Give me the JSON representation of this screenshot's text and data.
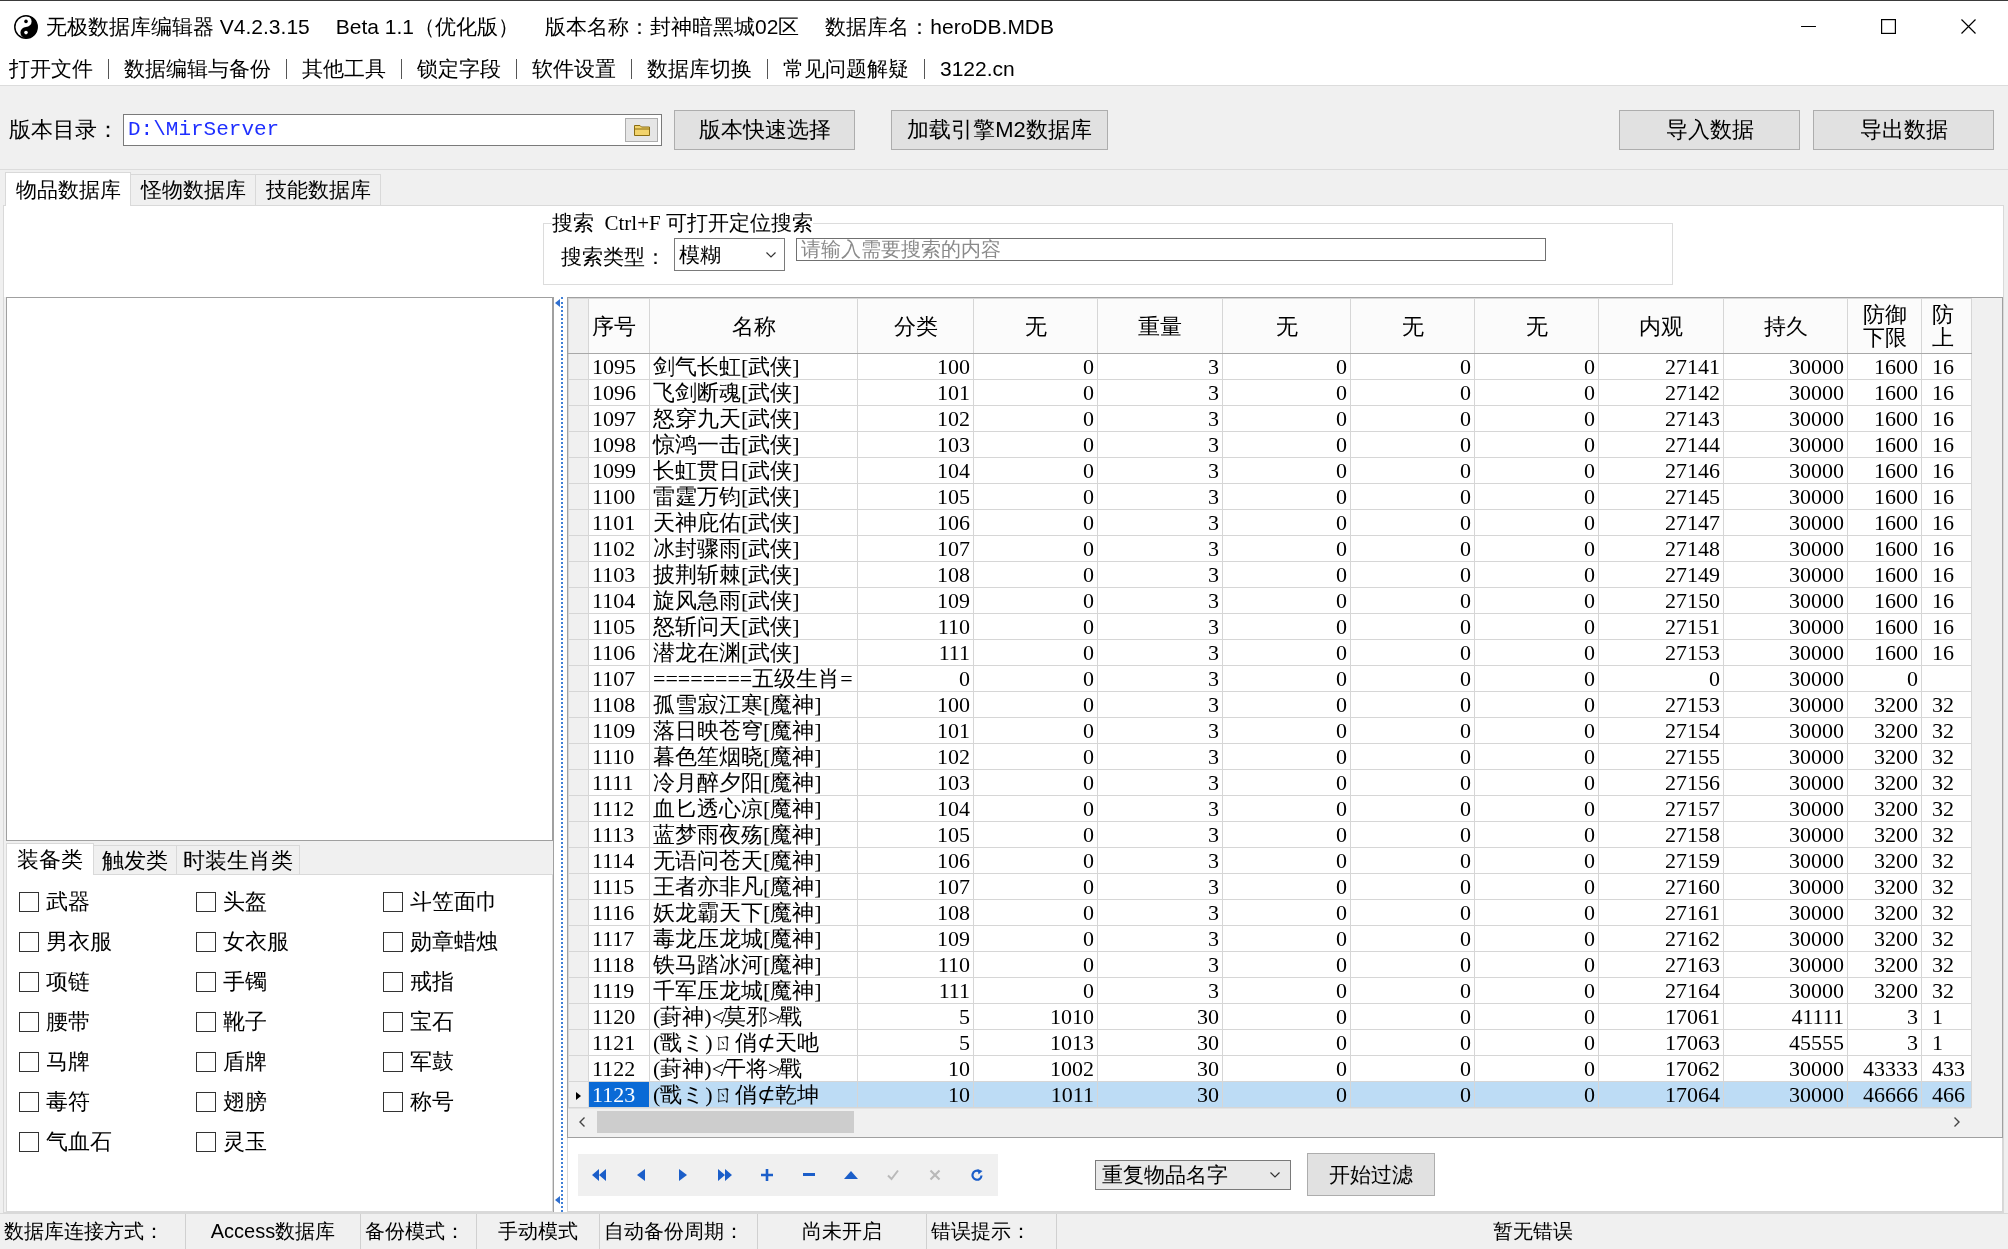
{
  "window": {
    "title_parts": [
      "无极数据库编辑器 V4.2.3.15",
      "Beta 1.1（优化版）",
      "版本名称：封神暗黑城02区",
      "数据库名：heroDB.MDB"
    ]
  },
  "menu": [
    "打开文件",
    "数据编辑与备份",
    "其他工具",
    "锁定字段",
    "软件设置",
    "数据库切换",
    "常见问题解疑",
    "3122.cn"
  ],
  "toolbar": {
    "path_label": "版本目录：",
    "path_value": "D:\\MirServer",
    "left_buttons": [
      "版本快速选择",
      "加载引擎M2数据库"
    ],
    "right_buttons": [
      "导入数据",
      "导出数据"
    ]
  },
  "tabs": [
    {
      "label": "物品数据库",
      "selected": true
    },
    {
      "label": "怪物数据库",
      "selected": false
    },
    {
      "label": "技能数据库",
      "selected": false
    }
  ],
  "search": {
    "title": "搜索  Ctrl+F 可打开定位搜索",
    "type_label": "搜索类型：",
    "type_value": "模糊",
    "placeholder": "请输入需要搜索的内容"
  },
  "category_tabs": [
    {
      "label": "装备类",
      "selected": true
    },
    {
      "label": "触发类",
      "selected": false
    },
    {
      "label": "时装生肖类",
      "selected": false
    }
  ],
  "categories": [
    {
      "label": "武器",
      "checked": false
    },
    {
      "label": "头盔",
      "checked": false
    },
    {
      "label": "斗笠面巾",
      "checked": false
    },
    {
      "label": "男衣服",
      "checked": false
    },
    {
      "label": "女衣服",
      "checked": false
    },
    {
      "label": "勋章蜡烛",
      "checked": false
    },
    {
      "label": "项链",
      "checked": false
    },
    {
      "label": "手镯",
      "checked": false
    },
    {
      "label": "戒指",
      "checked": false
    },
    {
      "label": "腰带",
      "checked": false
    },
    {
      "label": "靴子",
      "checked": false
    },
    {
      "label": "宝石",
      "checked": false
    },
    {
      "label": "马牌",
      "checked": false
    },
    {
      "label": "盾牌",
      "checked": false
    },
    {
      "label": "军鼓",
      "checked": false
    },
    {
      "label": "毒符",
      "checked": false
    },
    {
      "label": "翅膀",
      "checked": false
    },
    {
      "label": "称号",
      "checked": false
    },
    {
      "label": "气血石",
      "checked": false
    },
    {
      "label": "灵玉",
      "checked": false
    }
  ],
  "table": {
    "columns": [
      "序号",
      "名称",
      "分类",
      "无",
      "重量",
      "无",
      "无",
      "无",
      "内观",
      "持久",
      "防御下限",
      "防上"
    ],
    "rows": [
      {
        "selected": false,
        "cells": [
          "1095",
          "剑气长虹[武侠]",
          "100",
          "0",
          "3",
          "0",
          "0",
          "0",
          "27141",
          "30000",
          "1600",
          "16"
        ]
      },
      {
        "selected": false,
        "cells": [
          "1096",
          "飞剑断魂[武侠]",
          "101",
          "0",
          "3",
          "0",
          "0",
          "0",
          "27142",
          "30000",
          "1600",
          "16"
        ]
      },
      {
        "selected": false,
        "cells": [
          "1097",
          "怒穿九天[武侠]",
          "102",
          "0",
          "3",
          "0",
          "0",
          "0",
          "27143",
          "30000",
          "1600",
          "16"
        ]
      },
      {
        "selected": false,
        "cells": [
          "1098",
          "惊鸿一击[武侠]",
          "103",
          "0",
          "3",
          "0",
          "0",
          "0",
          "27144",
          "30000",
          "1600",
          "16"
        ]
      },
      {
        "selected": false,
        "cells": [
          "1099",
          "长虹贯日[武侠]",
          "104",
          "0",
          "3",
          "0",
          "0",
          "0",
          "27146",
          "30000",
          "1600",
          "16"
        ]
      },
      {
        "selected": false,
        "cells": [
          "1100",
          "雷霆万钧[武侠]",
          "105",
          "0",
          "3",
          "0",
          "0",
          "0",
          "27145",
          "30000",
          "1600",
          "16"
        ]
      },
      {
        "selected": false,
        "cells": [
          "1101",
          "天神庇佑[武侠]",
          "106",
          "0",
          "3",
          "0",
          "0",
          "0",
          "27147",
          "30000",
          "1600",
          "16"
        ]
      },
      {
        "selected": false,
        "cells": [
          "1102",
          "冰封骤雨[武侠]",
          "107",
          "0",
          "3",
          "0",
          "0",
          "0",
          "27148",
          "30000",
          "1600",
          "16"
        ]
      },
      {
        "selected": false,
        "cells": [
          "1103",
          "披荆斩棘[武侠]",
          "108",
          "0",
          "3",
          "0",
          "0",
          "0",
          "27149",
          "30000",
          "1600",
          "16"
        ]
      },
      {
        "selected": false,
        "cells": [
          "1104",
          "旋风急雨[武侠]",
          "109",
          "0",
          "3",
          "0",
          "0",
          "0",
          "27150",
          "30000",
          "1600",
          "16"
        ]
      },
      {
        "selected": false,
        "cells": [
          "1105",
          "怒斩问天[武侠]",
          "110",
          "0",
          "3",
          "0",
          "0",
          "0",
          "27151",
          "30000",
          "1600",
          "16"
        ]
      },
      {
        "selected": false,
        "cells": [
          "1106",
          "潜龙在渊[武侠]",
          "111",
          "0",
          "3",
          "0",
          "0",
          "0",
          "27153",
          "30000",
          "1600",
          "16"
        ]
      },
      {
        "selected": false,
        "cells": [
          "1107",
          "========五级生肖=",
          "0",
          "0",
          "3",
          "0",
          "0",
          "0",
          "0",
          "30000",
          "0"
        ]
      },
      {
        "selected": false,
        "cells": [
          "1108",
          "孤雪寂江寒[魔神]",
          "100",
          "0",
          "3",
          "0",
          "0",
          "0",
          "27153",
          "30000",
          "3200",
          "32"
        ]
      },
      {
        "selected": false,
        "cells": [
          "1109",
          "落日映苍穹[魔神]",
          "101",
          "0",
          "3",
          "0",
          "0",
          "0",
          "27154",
          "30000",
          "3200",
          "32"
        ]
      },
      {
        "selected": false,
        "cells": [
          "1110",
          "暮色笙烟晓[魔神]",
          "102",
          "0",
          "3",
          "0",
          "0",
          "0",
          "27155",
          "30000",
          "3200",
          "32"
        ]
      },
      {
        "selected": false,
        "cells": [
          "1111",
          "冷月醉夕阳[魔神]",
          "103",
          "0",
          "3",
          "0",
          "0",
          "0",
          "27156",
          "30000",
          "3200",
          "32"
        ]
      },
      {
        "selected": false,
        "cells": [
          "1112",
          "血匕透心凉[魔神]",
          "104",
          "0",
          "3",
          "0",
          "0",
          "0",
          "27157",
          "30000",
          "3200",
          "32"
        ]
      },
      {
        "selected": false,
        "cells": [
          "1113",
          "蓝梦雨夜殇[魔神]",
          "105",
          "0",
          "3",
          "0",
          "0",
          "0",
          "27158",
          "30000",
          "3200",
          "32"
        ]
      },
      {
        "selected": false,
        "cells": [
          "1114",
          "无语问苍天[魔神]",
          "106",
          "0",
          "3",
          "0",
          "0",
          "0",
          "27159",
          "30000",
          "3200",
          "32"
        ]
      },
      {
        "selected": false,
        "cells": [
          "1115",
          "王者亦非凡[魔神]",
          "107",
          "0",
          "3",
          "0",
          "0",
          "0",
          "27160",
          "30000",
          "3200",
          "32"
        ]
      },
      {
        "selected": false,
        "cells": [
          "1116",
          "妖龙霸天下[魔神]",
          "108",
          "0",
          "3",
          "0",
          "0",
          "0",
          "27161",
          "30000",
          "3200",
          "32"
        ]
      },
      {
        "selected": false,
        "cells": [
          "1117",
          "毒龙压龙城[魔神]",
          "109",
          "0",
          "3",
          "0",
          "0",
          "0",
          "27162",
          "30000",
          "3200",
          "32"
        ]
      },
      {
        "selected": false,
        "cells": [
          "1118",
          "铁马踏冰河[魔神]",
          "110",
          "0",
          "3",
          "0",
          "0",
          "0",
          "27163",
          "30000",
          "3200",
          "32"
        ]
      },
      {
        "selected": false,
        "cells": [
          "1119",
          "千军压龙城[魔神]",
          "111",
          "0",
          "3",
          "0",
          "0",
          "0",
          "27164",
          "30000",
          "3200",
          "32"
        ]
      },
      {
        "selected": false,
        "cells": [
          "1120",
          "(葑神)≮莫邪≯戰",
          "5",
          "1010",
          "30",
          "0",
          "0",
          "0",
          "17061",
          "41111",
          "3",
          "1"
        ]
      },
      {
        "selected": false,
        "cells": [
          "1121",
          "(戬ミ)ㄖ俏⊄天吔",
          "5",
          "1013",
          "30",
          "0",
          "0",
          "0",
          "17063",
          "45555",
          "3",
          "1"
        ]
      },
      {
        "selected": false,
        "cells": [
          "1122",
          "(葑神)≮干将≯戰",
          "10",
          "1002",
          "30",
          "0",
          "0",
          "0",
          "17062",
          "30000",
          "43333",
          "433"
        ]
      },
      {
        "selected": true,
        "cells": [
          "1123",
          "(戬ミ)ㄖ俏⊄乾坤",
          "10",
          "1011",
          "30",
          "0",
          "0",
          "0",
          "17064",
          "30000",
          "46666",
          "466"
        ]
      }
    ]
  },
  "navigator": [
    {
      "kind": "first",
      "disabled": false
    },
    {
      "kind": "prior",
      "disabled": false
    },
    {
      "kind": "next",
      "disabled": false
    },
    {
      "kind": "last",
      "disabled": false
    },
    {
      "kind": "insert",
      "disabled": false
    },
    {
      "kind": "delete",
      "disabled": false
    },
    {
      "kind": "edit",
      "disabled": false
    },
    {
      "kind": "post",
      "disabled": true
    },
    {
      "kind": "cancel",
      "disabled": true
    },
    {
      "kind": "refresh",
      "disabled": false
    }
  ],
  "filter": {
    "mode": "重复物品名字",
    "button": "开始过滤"
  },
  "status_bar": [
    {
      "label": "数据库连接方式：",
      "value": "Access数据库"
    },
    {
      "label": "备份模式：",
      "value": "手动模式"
    },
    {
      "label": "自动备份周期：",
      "value": "尚未开启"
    },
    {
      "label": "错误提示：",
      "value": "暂无错误"
    }
  ]
}
